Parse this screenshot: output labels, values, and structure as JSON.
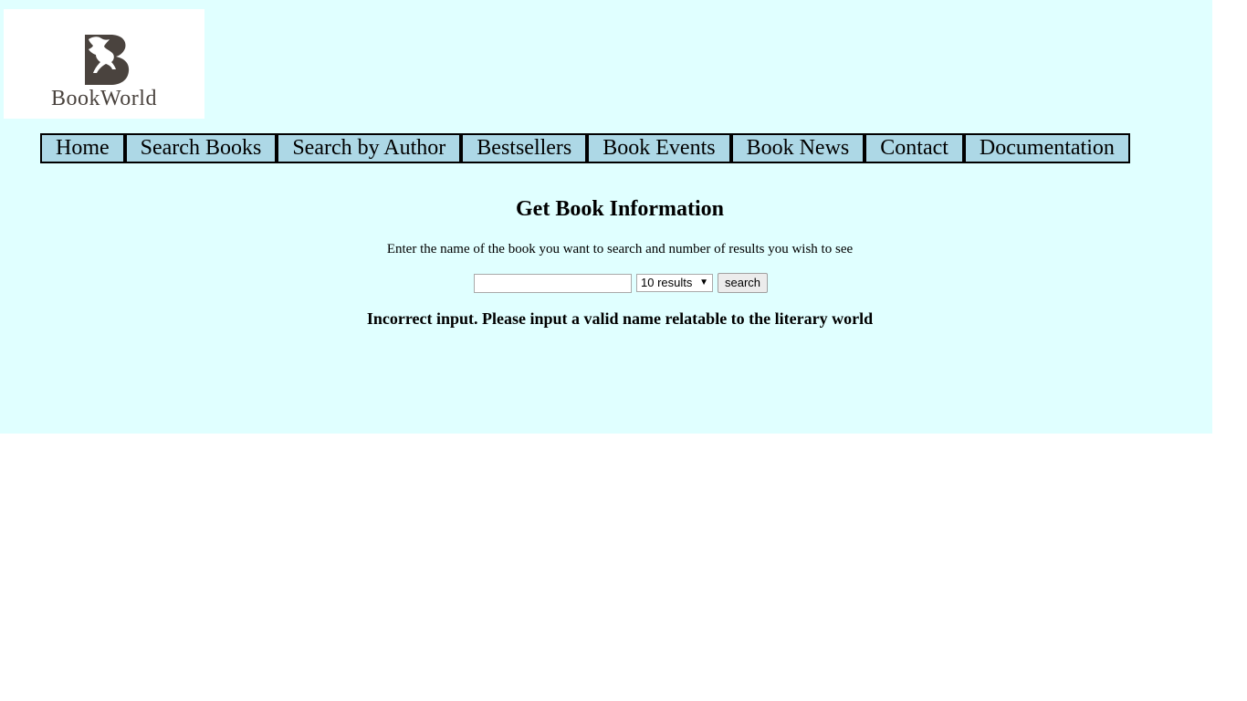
{
  "logo": {
    "text": "BookWorld",
    "icon": "horse-b-logo-icon",
    "color": "#4a433e"
  },
  "nav": {
    "items": [
      {
        "label": "Home"
      },
      {
        "label": "Search Books"
      },
      {
        "label": "Search by Author"
      },
      {
        "label": "Bestsellers"
      },
      {
        "label": "Book Events"
      },
      {
        "label": "Book News"
      },
      {
        "label": "Contact"
      },
      {
        "label": "Documentation"
      }
    ]
  },
  "main": {
    "title": "Get Book Information",
    "instructions": "Enter the name of the book you want to search and number of results you wish to see",
    "search_value": "",
    "search_placeholder": "",
    "results_selected": "10 results",
    "search_button": "search",
    "error_message": "Incorrect input. Please input a valid name relatable to the literary world"
  },
  "colors": {
    "page_bg": "#e0ffff",
    "nav_bg": "#add8e6",
    "nav_border": "#000000"
  }
}
